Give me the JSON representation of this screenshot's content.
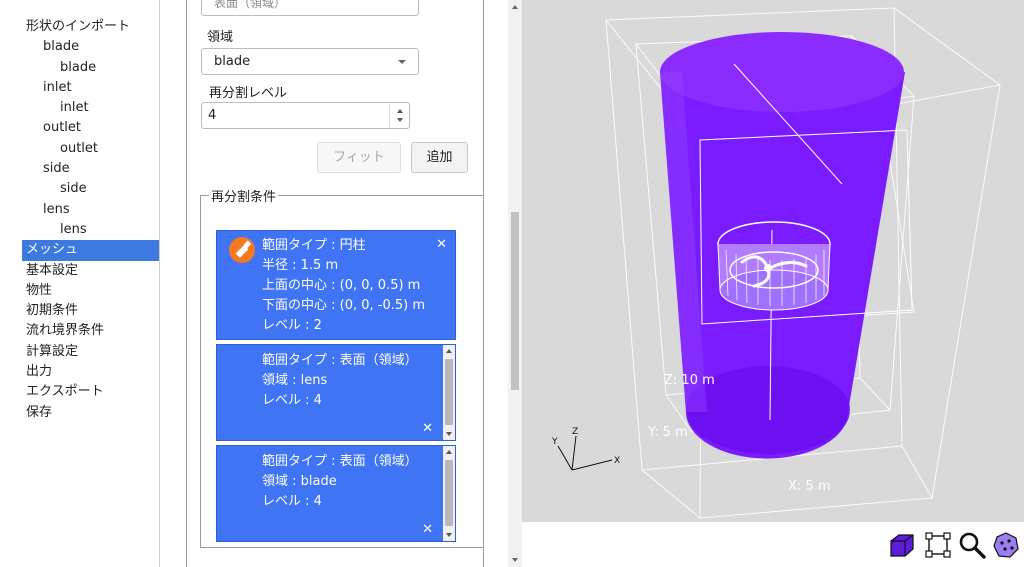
{
  "tree": {
    "items": [
      {
        "label": "形状のインポート",
        "level": 0
      },
      {
        "label": "blade",
        "level": 1
      },
      {
        "label": "blade",
        "level": 2
      },
      {
        "label": "inlet",
        "level": 1
      },
      {
        "label": "inlet",
        "level": 2
      },
      {
        "label": "outlet",
        "level": 1
      },
      {
        "label": "outlet",
        "level": 2
      },
      {
        "label": "side",
        "level": 1
      },
      {
        "label": "side",
        "level": 2
      },
      {
        "label": "lens",
        "level": 1
      },
      {
        "label": "lens",
        "level": 2
      },
      {
        "label": "メッシュ",
        "level": 0,
        "selected": true
      },
      {
        "label": "基本設定",
        "level": 0
      },
      {
        "label": "物性",
        "level": 0
      },
      {
        "label": "初期条件",
        "level": 0
      },
      {
        "label": "流れ境界条件",
        "level": 0
      },
      {
        "label": "計算設定",
        "level": 0
      },
      {
        "label": "出力",
        "level": 0
      },
      {
        "label": "エクスポート",
        "level": 0
      },
      {
        "label": "保存",
        "level": 0
      }
    ]
  },
  "form": {
    "top_field_value": "表面（領域）",
    "region_label": "領域",
    "region_value": "blade",
    "level_label": "再分割レベル",
    "level_value": "4",
    "fit_label": "フィット",
    "add_label": "追加",
    "conditions_legend": "再分割条件"
  },
  "conditions": [
    {
      "lines": [
        "範囲タイプ : 円柱",
        "半径 : 1.5 m",
        "上面の中心 : (0, 0, 0.5) m",
        "下面の中心 : (0, 0, -0.5) m",
        "レベル : 2"
      ],
      "close": "✕"
    },
    {
      "lines": [
        "範囲タイプ : 表面（領域）",
        "領域 : lens",
        "レベル : 4"
      ],
      "close": "✕"
    },
    {
      "lines": [
        "範囲タイプ : 表面（領域）",
        "領域 : blade",
        "レベル : 4"
      ],
      "close": "✕"
    }
  ],
  "viewport": {
    "dims": {
      "z": "Z: 10 m",
      "y": "Y: 5 m",
      "x": "X: 5 m"
    },
    "axes": {
      "x": "X",
      "y": "Y",
      "z": "Z"
    },
    "colors": {
      "background": "#d9d9d9",
      "cylinder": "#7a1cff",
      "selection": "#3f74f5"
    }
  },
  "toolbar": {
    "icons": [
      "solid-view-icon",
      "fit-bounds-icon",
      "zoom-icon",
      "vertex-icon"
    ]
  }
}
